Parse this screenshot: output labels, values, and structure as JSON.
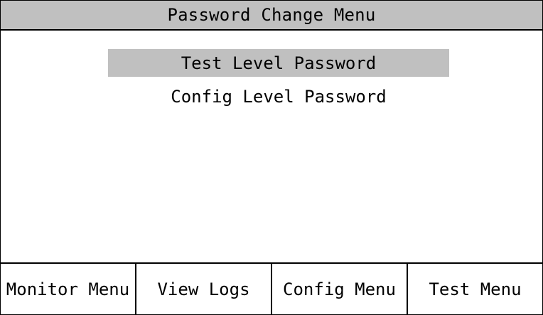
{
  "header": {
    "title": "Password Change Menu"
  },
  "menu": {
    "items": [
      {
        "label": "Test Level Password",
        "selected": true
      },
      {
        "label": "Config Level Password",
        "selected": false
      }
    ]
  },
  "softkeys": [
    {
      "label": "Monitor Menu"
    },
    {
      "label": "View Logs"
    },
    {
      "label": "Config Menu"
    },
    {
      "label": "Test Menu"
    }
  ],
  "colors": {
    "title_bar_bg": "#c0c0c0",
    "highlight_bg": "#c0c0c0",
    "background": "#ffffff",
    "text": "#000000"
  }
}
